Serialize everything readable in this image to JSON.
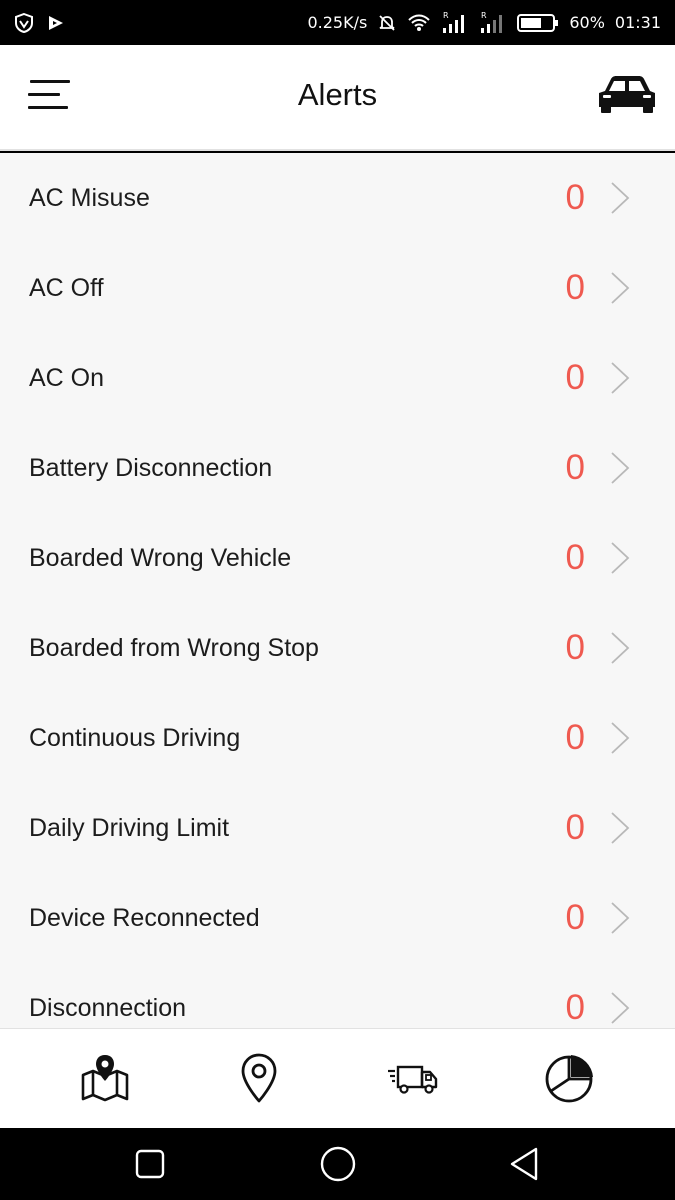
{
  "status_bar": {
    "net_speed": "0.25K/s",
    "battery": "60%",
    "time": "01:31"
  },
  "header": {
    "title": "Alerts"
  },
  "alerts": [
    {
      "label": "AC Misuse",
      "count": "0"
    },
    {
      "label": "AC Off",
      "count": "0"
    },
    {
      "label": "AC On",
      "count": "0"
    },
    {
      "label": "Battery Disconnection",
      "count": "0"
    },
    {
      "label": "Boarded Wrong Vehicle",
      "count": "0"
    },
    {
      "label": "Boarded from Wrong Stop",
      "count": "0"
    },
    {
      "label": "Continuous Driving",
      "count": "0"
    },
    {
      "label": "Daily Driving Limit",
      "count": "0"
    },
    {
      "label": "Device Reconnected",
      "count": "0"
    },
    {
      "label": "Disconnection",
      "count": "0"
    }
  ],
  "bottom_tabs": [
    "map-icon",
    "location-pin-icon",
    "delivery-truck-icon",
    "pie-chart-icon"
  ],
  "colors": {
    "count": "#ef5a50",
    "list_bg": "#f7f7f7",
    "header_bg": "#ffffff"
  }
}
